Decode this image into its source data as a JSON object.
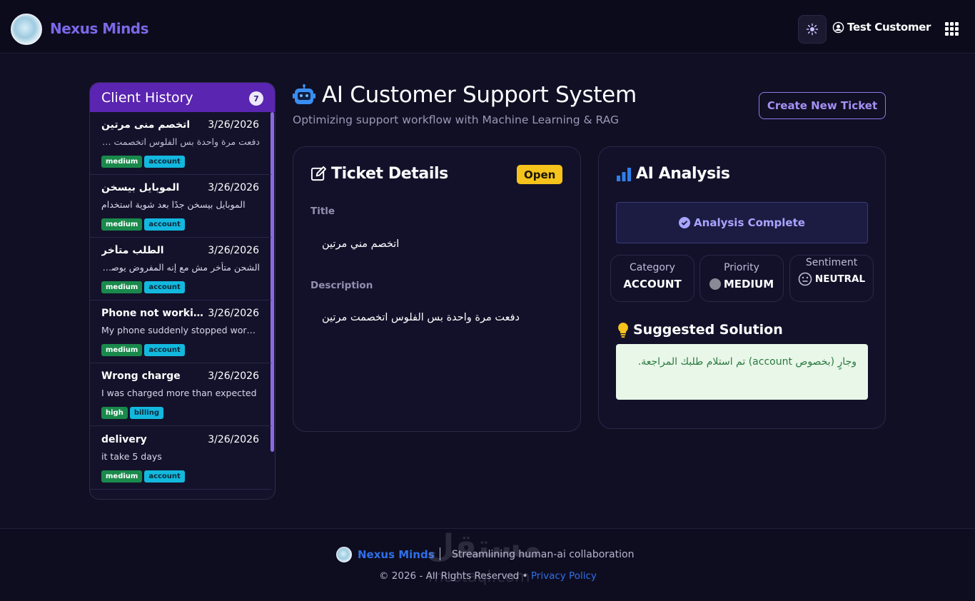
{
  "header": {
    "brand": "Nexus Minds",
    "user_name": "Test Customer"
  },
  "sidebar": {
    "title": "Client History",
    "count": "7",
    "items": [
      {
        "title": "اتخصم منى مرتين",
        "date": "3/26/2026",
        "desc": "دفعت مرة واحدة بس الفلوس اتخصمت مرتين",
        "priority": "medium",
        "category": "account"
      },
      {
        "title": "الموبايل بيسخن",
        "date": "3/26/2026",
        "desc": "الموبايل بيسخن جدًا بعد شوية استخدام",
        "priority": "medium",
        "category": "account"
      },
      {
        "title": "الطلب متأخر",
        "date": "3/26/2026",
        "desc": "الشحن متأخر مش مع إنه المفروض يوصل من يومين",
        "priority": "medium",
        "category": "account"
      },
      {
        "title": "Phone not working",
        "date": "3/26/2026",
        "desc": "My phone suddenly stopped working",
        "priority": "medium",
        "category": "account"
      },
      {
        "title": "Wrong charge",
        "date": "3/26/2026",
        "desc": "I was charged more than expected",
        "priority": "high",
        "category": "billing"
      },
      {
        "title": "delivery",
        "date": "3/26/2026",
        "desc": "it take 5 days",
        "priority": "medium",
        "category": "account"
      }
    ]
  },
  "main": {
    "title": "AI Customer Support System",
    "subtitle": "Optimizing support workflow with Machine Learning & RAG",
    "create_button": "Create New Ticket"
  },
  "ticket": {
    "heading": "Ticket Details",
    "status": "Open",
    "title_label": "Title",
    "title_value": "اتخصم مني مرتين",
    "description_label": "Description",
    "description_value": "دفعت مرة واحدة بس الفلوس اتخصمت مرتين"
  },
  "analysis": {
    "heading": "AI Analysis",
    "status": "Analysis Complete",
    "category_label": "Category",
    "category_value": "ACCOUNT",
    "priority_label": "Priority",
    "priority_value": "MEDIUM",
    "sentiment_label": "Sentiment",
    "sentiment_value": "NEUTRAL",
    "solution_heading": "Suggested Solution",
    "solution_text": "وجارٍ (بخصوص account) تم استلام طلبك المراجعة."
  },
  "footer": {
    "brand": "Nexus Minds",
    "tagline": "Streamlining human-ai collaboration",
    "copyright": "© 2026 - All Rights Reserved •",
    "privacy": "Privacy Policy",
    "watermark": "مستقل",
    "watermark_latin": "mostaql.com"
  },
  "colors": {
    "accent": "#7b68e8",
    "sidebar_header": "#5a25b0",
    "status_open": "#f6c21c",
    "tag_priority": "#1a8a4c",
    "tag_category": "#13b8de",
    "link": "#2f6fe8"
  }
}
